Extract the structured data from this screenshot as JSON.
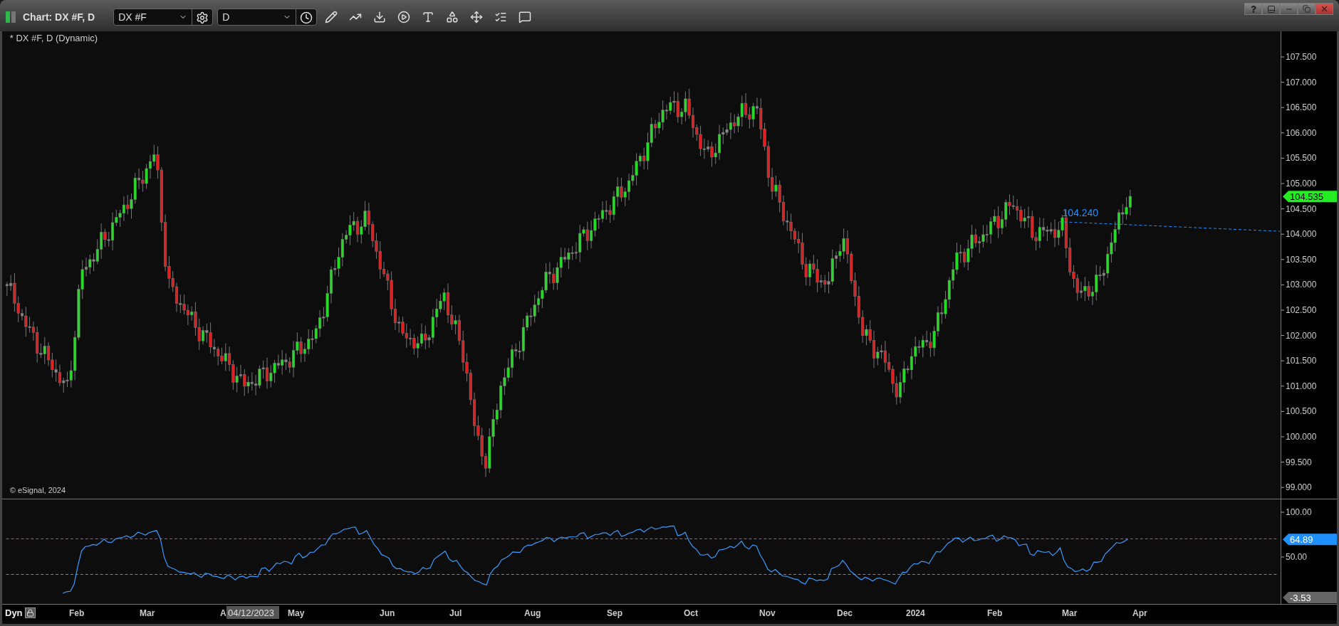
{
  "window": {
    "title": "Chart: DX #F, D"
  },
  "toolbar": {
    "symbol": "DX #F",
    "interval": "D"
  },
  "chart": {
    "legend": "* DX #F, D (Dynamic)",
    "copyright": "© eSignal, 2024",
    "price_axis": [
      "107.500",
      "107.000",
      "106.500",
      "106.000",
      "105.500",
      "105.000",
      "104.500",
      "104.000",
      "103.500",
      "103.000",
      "102.500",
      "102.000",
      "101.500",
      "101.000",
      "100.500",
      "100.000",
      "99.500",
      "99.000"
    ],
    "last_price": "104.535",
    "trendline_label": "104.240"
  },
  "indicator": {
    "axis": [
      "100.00",
      "50.00"
    ],
    "last_value": "64.89",
    "min_value": "-3.53"
  },
  "time_axis": {
    "mode": "Dyn",
    "labels": [
      "Feb",
      "Mar",
      "A",
      "May",
      "Jun",
      "Jul",
      "Aug",
      "Sep",
      "Oct",
      "Nov",
      "Dec",
      "2024",
      "Feb",
      "Mar",
      "Apr"
    ],
    "cursor_date": "04/12/2023"
  }
}
